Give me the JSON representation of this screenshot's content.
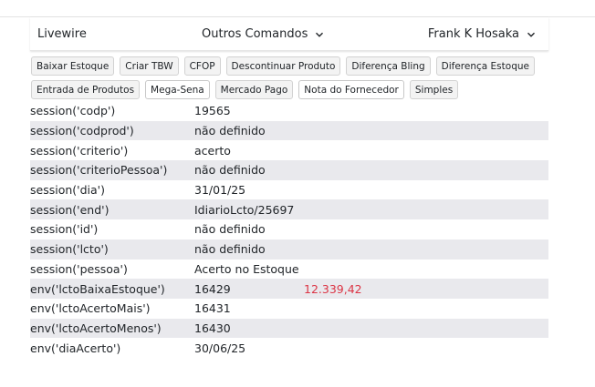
{
  "navbar": {
    "brand": "Livewire",
    "center_menu": "Outros Comandos",
    "user_menu": "Frank K Hosaka"
  },
  "buttons_row1": [
    {
      "label": "Baixar Estoque",
      "key": "baixar-estoque"
    },
    {
      "label": "Criar TBW",
      "key": "criar-tbw"
    },
    {
      "label": "CFOP",
      "key": "cfop"
    },
    {
      "label": "Descontinuar Produto",
      "key": "descontinuar-produto"
    },
    {
      "label": "Diferença Bling",
      "key": "diferenca-bling"
    },
    {
      "label": "Diferença Estoque",
      "key": "diferenca-estoque"
    }
  ],
  "buttons_row2": [
    {
      "label": "Entrada de Produtos",
      "key": "entrada-de-produtos"
    },
    {
      "label": "Mega-Sena",
      "key": "mega-sena"
    },
    {
      "label": "Mercado Pago",
      "key": "mercado-pago"
    },
    {
      "label": "Nota do Fornecedor",
      "key": "nota-do-fornecedor"
    },
    {
      "label": "Simples",
      "key": "simples"
    }
  ],
  "rows": [
    {
      "key": "session('codp')",
      "value": "19565",
      "extra": ""
    },
    {
      "key": "session('codprod')",
      "value": "não definido",
      "extra": ""
    },
    {
      "key": "session('criterio')",
      "value": "acerto",
      "extra": ""
    },
    {
      "key": "session('criterioPessoa')",
      "value": "não definido",
      "extra": ""
    },
    {
      "key": "session('dia')",
      "value": "31/01/25",
      "extra": ""
    },
    {
      "key": "session('end')",
      "value": "IdiarioLcto/25697",
      "extra": ""
    },
    {
      "key": "session('id')",
      "value": "não definido",
      "extra": ""
    },
    {
      "key": "session('lcto')",
      "value": "não definido",
      "extra": ""
    },
    {
      "key": "session('pessoa')",
      "value": "Acerto no Estoque",
      "extra": ""
    },
    {
      "key": "env('lctoBaixaEstoque')",
      "value": "16429",
      "extra": "12.339,42"
    },
    {
      "key": "env('lctoAcertoMais')",
      "value": "16431",
      "extra": ""
    },
    {
      "key": "env('lctoAcertoMenos')",
      "value": "16430",
      "extra": ""
    },
    {
      "key": "env('diaAcerto')",
      "value": "30/06/25",
      "extra": ""
    }
  ],
  "colors": {
    "alt_row": "#e9e9ed",
    "extra_value": "#dc3545"
  }
}
